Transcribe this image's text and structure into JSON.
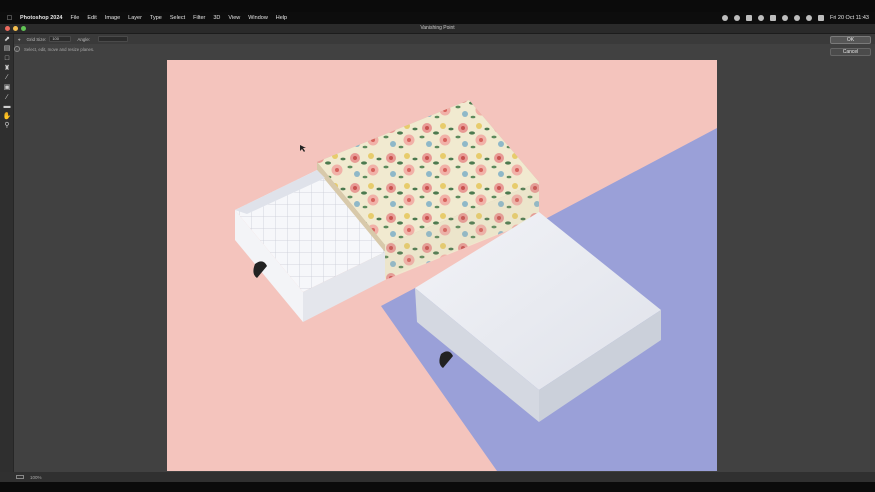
{
  "menubar": {
    "app_name": "Photoshop 2024",
    "items": [
      "File",
      "Edit",
      "Image",
      "Layer",
      "Type",
      "Select",
      "Filter",
      "3D",
      "View",
      "Window",
      "Help"
    ],
    "clock": "Fri 20 Oct  11:43"
  },
  "window": {
    "title": "Vanishing Point"
  },
  "options": {
    "grid_label": "Grid Size:",
    "grid_value": "100",
    "angle_label": "Angle:"
  },
  "info": {
    "text": "Select, edit, move and resize planes."
  },
  "buttons": {
    "ok": "OK",
    "cancel": "Cancel"
  },
  "status": {
    "zoom": "100%"
  },
  "tools": [
    "edit-plane-tool-icon",
    "create-plane-tool-icon",
    "marquee-tool-icon",
    "stamp-tool-icon",
    "brush-tool-icon",
    "transform-tool-icon",
    "eyedropper-tool-icon",
    "measure-tool-icon",
    "hand-tool-icon",
    "zoom-tool-icon"
  ],
  "colors": {
    "background_pink": "#f4c4bd",
    "background_lavender": "#9aa0d8",
    "box_white": "#e8ebf0",
    "floral_base": "#f1ead0"
  }
}
